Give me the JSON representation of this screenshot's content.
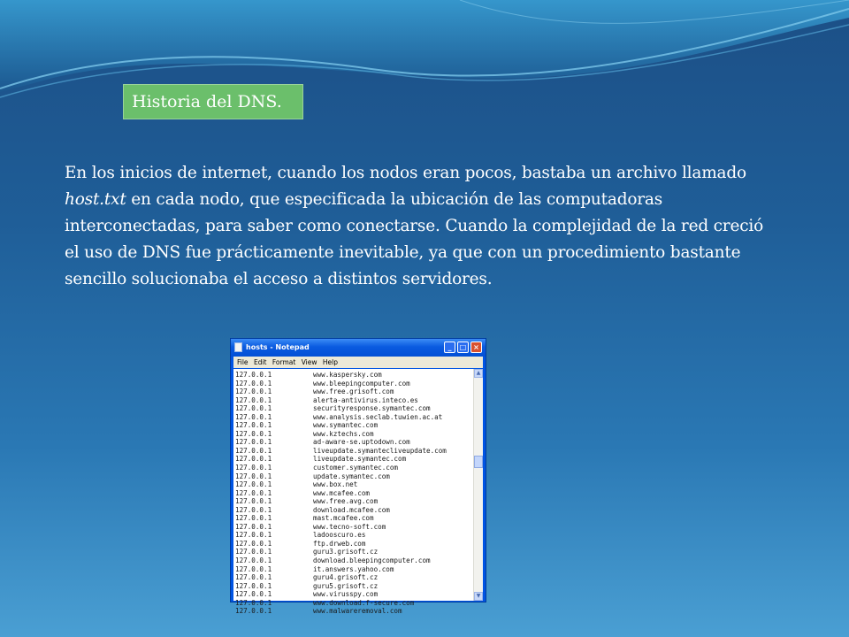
{
  "slide": {
    "title": "Historia del DNS.",
    "paragraph_part1": "En los inicios de internet, cuando los nodos eran pocos, bastaba un archivo llamado ",
    "paragraph_italic": "host.txt",
    "paragraph_part2": " en cada nodo, que especificada la ubicación de las computadoras interconectadas, para saber como conectarse. Cuando la complejidad de la red creció el uso de DNS fue prácticamente inevitable, ya que con un procedimiento bastante sencillo solucionaba el acceso a distintos servidores."
  },
  "notepad": {
    "title": "hosts - Notepad",
    "menu": [
      "File",
      "Edit",
      "Format",
      "View",
      "Help"
    ],
    "entries": [
      {
        "ip": "127.0.0.1",
        "host": "www.kaspersky.com"
      },
      {
        "ip": "127.0.0.1",
        "host": "www.bleepingcomputer.com"
      },
      {
        "ip": "127.0.0.1",
        "host": "www.free.grisoft.com"
      },
      {
        "ip": "127.0.0.1",
        "host": "alerta-antivirus.inteco.es"
      },
      {
        "ip": "127.0.0.1",
        "host": "securityresponse.symantec.com"
      },
      {
        "ip": "127.0.0.1",
        "host": "www.analysis.seclab.tuwien.ac.at"
      },
      {
        "ip": "127.0.0.1",
        "host": "www.symantec.com"
      },
      {
        "ip": "127.0.0.1",
        "host": "www.kztechs.com"
      },
      {
        "ip": "127.0.0.1",
        "host": "ad-aware-se.uptodown.com"
      },
      {
        "ip": "127.0.0.1",
        "host": "liveupdate.symantecliveupdate.com"
      },
      {
        "ip": "127.0.0.1",
        "host": "liveupdate.symantec.com"
      },
      {
        "ip": "127.0.0.1",
        "host": "customer.symantec.com"
      },
      {
        "ip": "127.0.0.1",
        "host": "update.symantec.com"
      },
      {
        "ip": "127.0.0.1",
        "host": "www.box.net"
      },
      {
        "ip": "127.0.0.1",
        "host": "www.mcafee.com"
      },
      {
        "ip": "127.0.0.1",
        "host": "www.free.avg.com"
      },
      {
        "ip": "127.0.0.1",
        "host": "download.mcafee.com"
      },
      {
        "ip": "127.0.0.1",
        "host": "mast.mcafee.com"
      },
      {
        "ip": "127.0.0.1",
        "host": "www.tecno-soft.com"
      },
      {
        "ip": "127.0.0.1",
        "host": "ladooscuro.es"
      },
      {
        "ip": "127.0.0.1",
        "host": "ftp.drweb.com"
      },
      {
        "ip": "127.0.0.1",
        "host": "guru3.grisoft.cz"
      },
      {
        "ip": "127.0.0.1",
        "host": "download.bleepingcomputer.com"
      },
      {
        "ip": "127.0.0.1",
        "host": "it.answers.yahoo.com"
      },
      {
        "ip": "127.0.0.1",
        "host": "guru4.grisoft.cz"
      },
      {
        "ip": "127.0.0.1",
        "host": "guru5.grisoft.cz"
      },
      {
        "ip": "127.0.0.1",
        "host": "www.virusspy.com"
      },
      {
        "ip": "127.0.0.1",
        "host": "www.download.f-secure.com"
      },
      {
        "ip": "127.0.0.1",
        "host": "www.malwareremoval.com"
      }
    ]
  }
}
